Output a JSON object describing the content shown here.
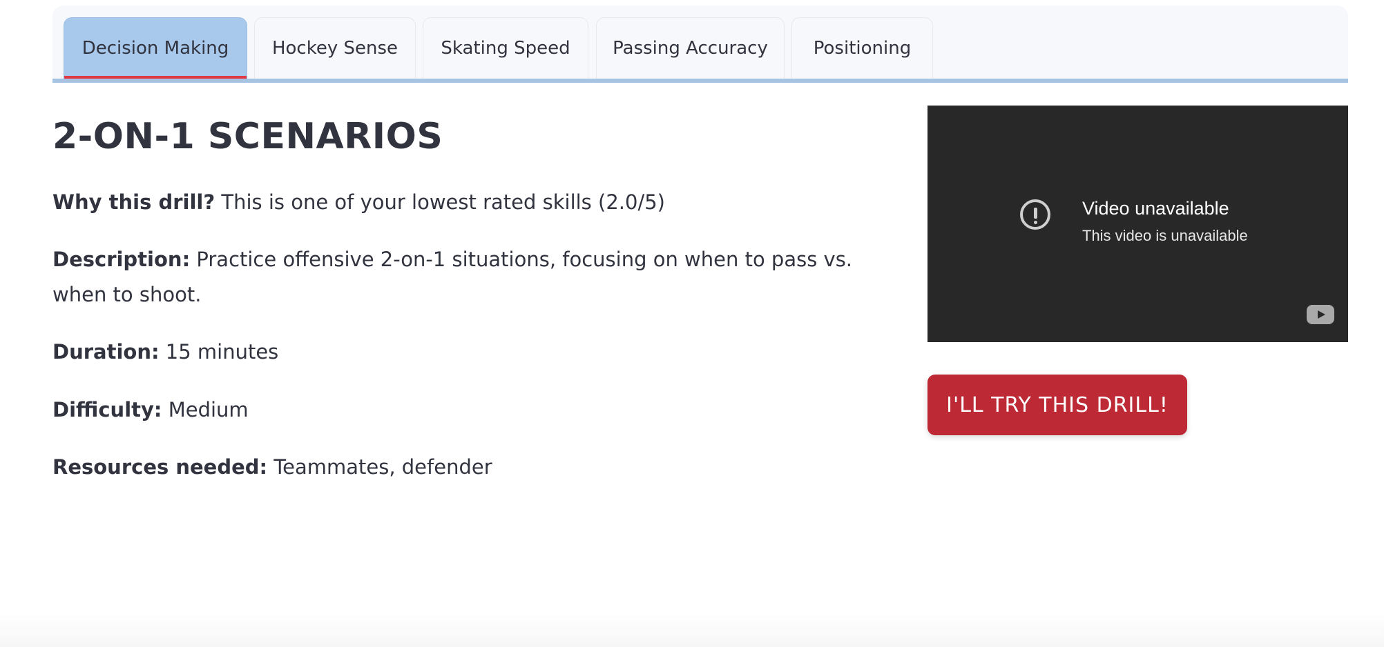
{
  "tabs": [
    {
      "label": "Decision Making",
      "active": true
    },
    {
      "label": "Hockey Sense",
      "active": false
    },
    {
      "label": "Skating Speed",
      "active": false
    },
    {
      "label": "Passing Accuracy",
      "active": false
    },
    {
      "label": "Positioning",
      "active": false
    }
  ],
  "drill": {
    "title": "2-ON-1 SCENARIOS",
    "why_label": "Why this drill?",
    "why_text": "This is one of your lowest rated skills (2.0/5)",
    "description_label": "Description:",
    "description_text": "Practice offensive 2-on-1 situations, focusing on when to pass vs. when to shoot.",
    "duration_label": "Duration:",
    "duration_text": "15 minutes",
    "difficulty_label": "Difficulty:",
    "difficulty_text": "Medium",
    "resources_label": "Resources needed:",
    "resources_text": "Teammates, defender"
  },
  "video": {
    "title": "Video unavailable",
    "subtitle": "This video is unavailable",
    "status_icon": "alert-circle-icon",
    "logo_icon": "youtube-logo-icon"
  },
  "action": {
    "button_label": "I'LL TRY THIS DRILL!"
  },
  "colors": {
    "active_tab": "#a8c9ec",
    "active_tab_indicator": "#dd3a43",
    "button": "#bd2a36",
    "video_bg": "#282828",
    "text": "#31333f"
  }
}
